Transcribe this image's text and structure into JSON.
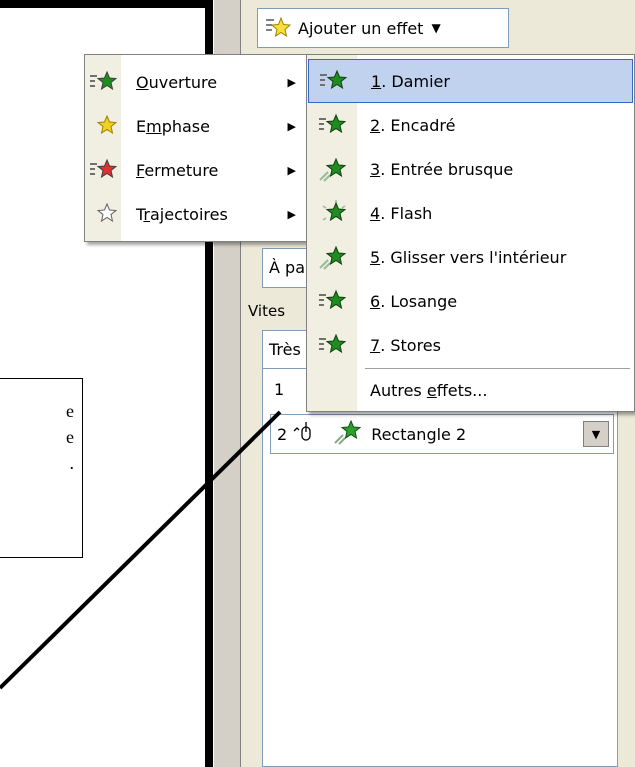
{
  "callout": {
    "line1": "e",
    "line2": "e",
    "line3": "."
  },
  "toolbar": {
    "add_effect_label": "Ajouter un effet",
    "add_effect_arrow": "▼"
  },
  "pane": {
    "start_value": "À pa",
    "speed_label": "Vites",
    "speed_value": "Très"
  },
  "effect_list": {
    "row1_number": "1",
    "row2_number": "2",
    "row2_name": "Rectangle 2"
  },
  "categories": [
    {
      "pre": "",
      "key": "O",
      "post": "uverture",
      "icon": "entrance-star-icon",
      "color": "#1e8c1e"
    },
    {
      "pre": "E",
      "key": "m",
      "post": "phase",
      "icon": "emphasis-star-icon",
      "color": "#f0d020"
    },
    {
      "pre": "",
      "key": "F",
      "post": "ermeture",
      "icon": "exit-star-icon",
      "color": "#e03030"
    },
    {
      "pre": "T",
      "key": "r",
      "post": "ajectoires",
      "icon": "motion-path-star-icon",
      "color": "#ffffff"
    }
  ],
  "effects": [
    {
      "key": "1",
      "label": ". Damier",
      "icon": "checkerboard-effect-icon"
    },
    {
      "key": "2",
      "label": ". Encadré",
      "icon": "box-effect-icon"
    },
    {
      "key": "3",
      "label": ". Entrée brusque",
      "icon": "fly-in-effect-icon"
    },
    {
      "key": "4",
      "label": ". Flash",
      "icon": "flash-effect-icon"
    },
    {
      "key": "5",
      "label": ". Glisser vers l'intérieur",
      "icon": "crawl-in-effect-icon"
    },
    {
      "key": "6",
      "label": ". Losange",
      "icon": "diamond-effect-icon"
    },
    {
      "key": "7",
      "label": ". Stores",
      "icon": "blinds-effect-icon"
    }
  ],
  "more_effects": {
    "pre": "Autres ",
    "key": "e",
    "post": "ffets..."
  },
  "colors": {
    "highlight_bg": "#c1d2ee",
    "highlight_border": "#316ac5",
    "pane_bg": "#ece9d8",
    "entrance_green": "#1e8c1e"
  }
}
